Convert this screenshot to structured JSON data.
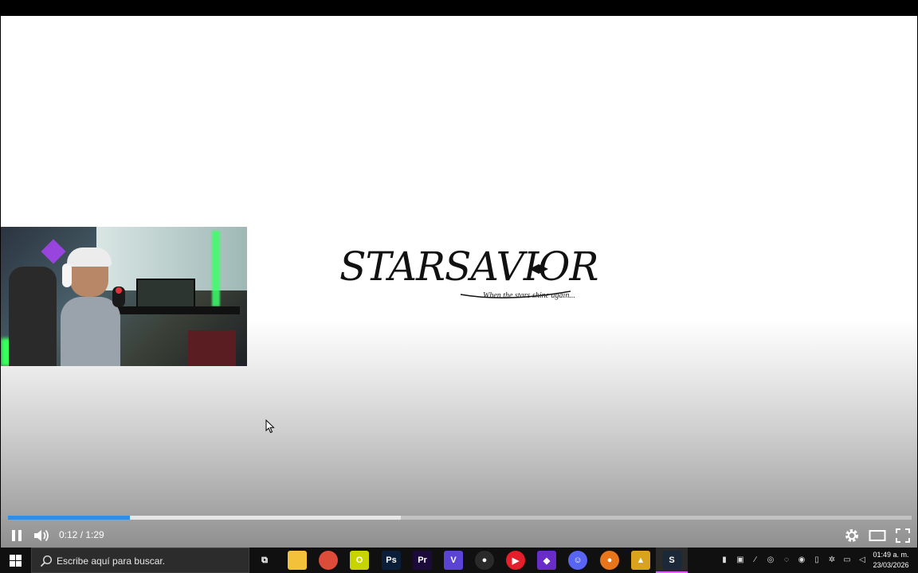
{
  "video": {
    "logo_title": "STARSAVIOR",
    "logo_tagline": "When the stars shine again...",
    "progress": {
      "played_fraction": 0.135,
      "buffered_fraction": 0.435
    },
    "accent_color": "#2f8ee6"
  },
  "player_controls": {
    "time": "0:12 / 1:29",
    "icons": [
      "pause-icon",
      "volume-icon",
      "settings-gear-icon",
      "theater-mode-icon",
      "fullscreen-icon"
    ]
  },
  "taskbar": {
    "search_placeholder": "Escribe aquí para buscar.",
    "apps": [
      {
        "name": "task-view",
        "glyph": "⧉",
        "color": "#101010"
      },
      {
        "name": "file-explorer",
        "glyph": "",
        "color": "#f3c13a"
      },
      {
        "name": "chrome",
        "glyph": "",
        "color": "#dd4b39"
      },
      {
        "name": "opera-gx",
        "glyph": "O",
        "color": "#c8d400"
      },
      {
        "name": "photoshop",
        "glyph": "Ps",
        "color": "#0b1f3b"
      },
      {
        "name": "premiere",
        "glyph": "Pr",
        "color": "#1c0b3a"
      },
      {
        "name": "v-app",
        "glyph": "V",
        "color": "#5b43d6"
      },
      {
        "name": "obs",
        "glyph": "●",
        "color": "#2a2a2a"
      },
      {
        "name": "youtube-music",
        "glyph": "▶",
        "color": "#e41e2b"
      },
      {
        "name": "streaming-app",
        "glyph": "◆",
        "color": "#6a2cc9"
      },
      {
        "name": "discord",
        "glyph": "☺",
        "color": "#5865f2"
      },
      {
        "name": "browser-app",
        "glyph": "●",
        "color": "#e8751a"
      },
      {
        "name": "launcher-app",
        "glyph": "▲",
        "color": "#d9a31b"
      },
      {
        "name": "steam",
        "glyph": "S",
        "color": "#1b2838"
      }
    ],
    "tray": [
      "app-tray-icon",
      "nvidia-icon",
      "pen-icon",
      "steam-tray-icon",
      "vpn-icon",
      "chrome-tray-icon",
      "usb-icon",
      "bluetooth-icon",
      "network-icon",
      "speaker-icon"
    ],
    "clock_time": "01:49 a. m.",
    "clock_date": "23/03/2026"
  }
}
